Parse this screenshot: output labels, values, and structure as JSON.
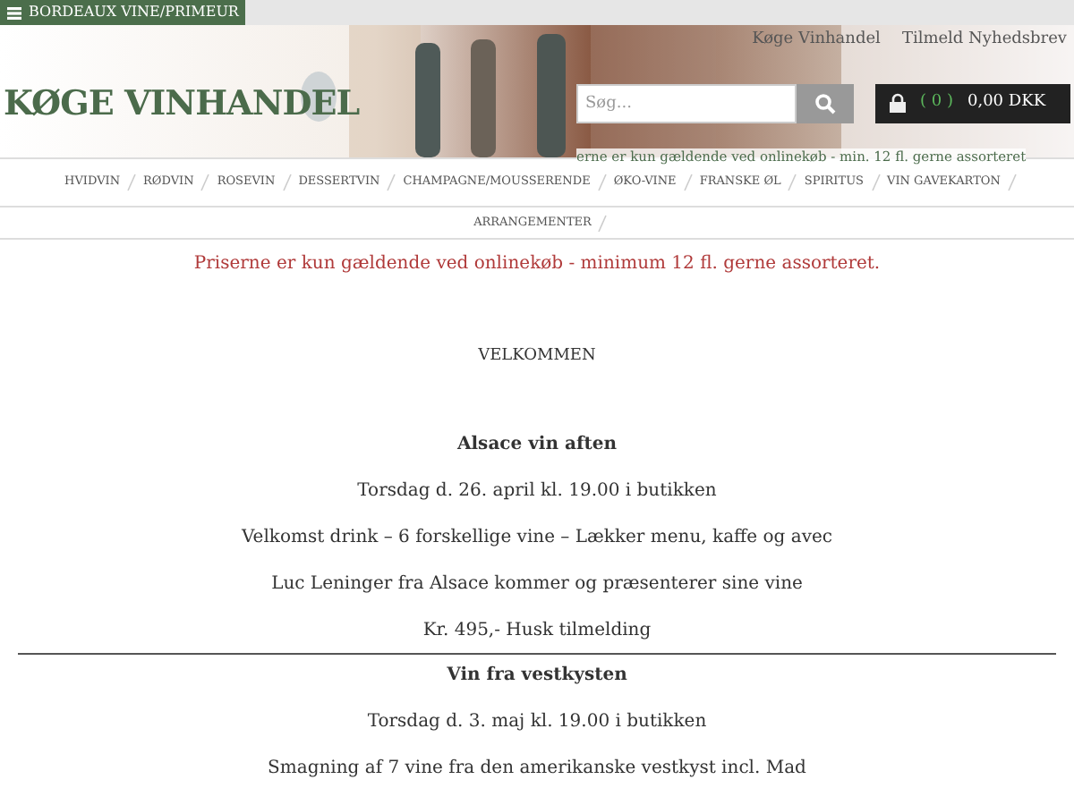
{
  "top_bar": {
    "menu_button": "BORDEAUX VINE/PRIMEUR"
  },
  "header": {
    "logo": "KØGE VINHANDEL",
    "links": [
      "Køge Vinhandel",
      "Tilmeld Nyhedsbrev"
    ],
    "search": {
      "placeholder": "Søg..."
    },
    "cart": {
      "count": "( 0 )",
      "total": "0,00 DKK"
    },
    "ticker": "erne er kun gældende ved onlinekøb - min. 12 fl. gerne assorteret"
  },
  "nav": [
    "HVIDVIN",
    "RØDVIN",
    "ROSEVIN",
    "DESSERTVIN",
    "CHAMPAGNE/MOUSSERENDE",
    "ØKO-VINE",
    "FRANSKE ØL",
    "SPIRITUS",
    "VIN GAVEKARTON",
    "ARRANGEMENTER"
  ],
  "notice": "Priserne er kun gældende ved onlinekøb - minimum 12 fl. gerne assorteret.",
  "content": [
    {
      "kind": "title",
      "text": "VELKOMMEN"
    },
    {
      "kind": "heading",
      "text": "Alsace vin aften"
    },
    {
      "kind": "line",
      "text": "Torsdag d. 26. april kl. 19.00 i butikken"
    },
    {
      "kind": "line",
      "text": "Velkomst drink – 6 forskellige vine – Lækker menu, kaffe og avec"
    },
    {
      "kind": "line",
      "text": "Luc Leninger fra Alsace kommer og præsenterer sine vine"
    },
    {
      "kind": "line",
      "text": "Kr. 495,- Husk tilmelding"
    },
    {
      "kind": "rule"
    },
    {
      "kind": "heading",
      "text": "Vin fra vestkysten"
    },
    {
      "kind": "line",
      "text": "Torsdag d. 3. maj kl. 19.00 i butikken"
    },
    {
      "kind": "line",
      "text": "Smagning af 7 vine fra den amerikanske vestkyst incl. Mad"
    }
  ]
}
